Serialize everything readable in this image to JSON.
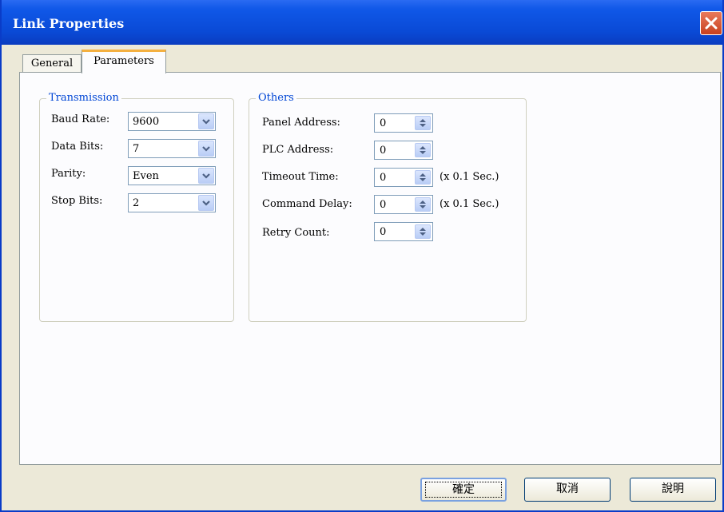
{
  "window": {
    "title": "Link Properties"
  },
  "tabs": {
    "general": "General",
    "parameters": "Parameters"
  },
  "transmission": {
    "legend": "Transmission",
    "baud_rate": {
      "label": "Baud Rate:",
      "value": "9600"
    },
    "data_bits": {
      "label": "Data Bits:",
      "value": "7"
    },
    "parity": {
      "label": "Parity:",
      "value": "Even"
    },
    "stop_bits": {
      "label": "Stop Bits:",
      "value": "2"
    }
  },
  "others": {
    "legend": "Others",
    "panel_address": {
      "label": "Panel Address:",
      "value": "0"
    },
    "plc_address": {
      "label": "PLC Address:",
      "value": "0"
    },
    "timeout_time": {
      "label": "Timeout Time:",
      "value": "0",
      "unit": "(x 0.1 Sec.)"
    },
    "command_delay": {
      "label": "Command Delay:",
      "value": "0",
      "unit": "(x 0.1 Sec.)"
    },
    "retry_count": {
      "label": "Retry Count:",
      "value": "0"
    }
  },
  "buttons": {
    "ok": "確定",
    "cancel": "取消",
    "help": "說明"
  },
  "icons": {
    "close": "close-icon",
    "dropdown": "chevron-down-icon",
    "spinner": "spinner-arrows-icon"
  },
  "colors": {
    "title_bar": "#0a4ad6",
    "legend_text": "#0046d5",
    "tab_highlight": "#f4b040",
    "close_button": "#c8401e"
  }
}
